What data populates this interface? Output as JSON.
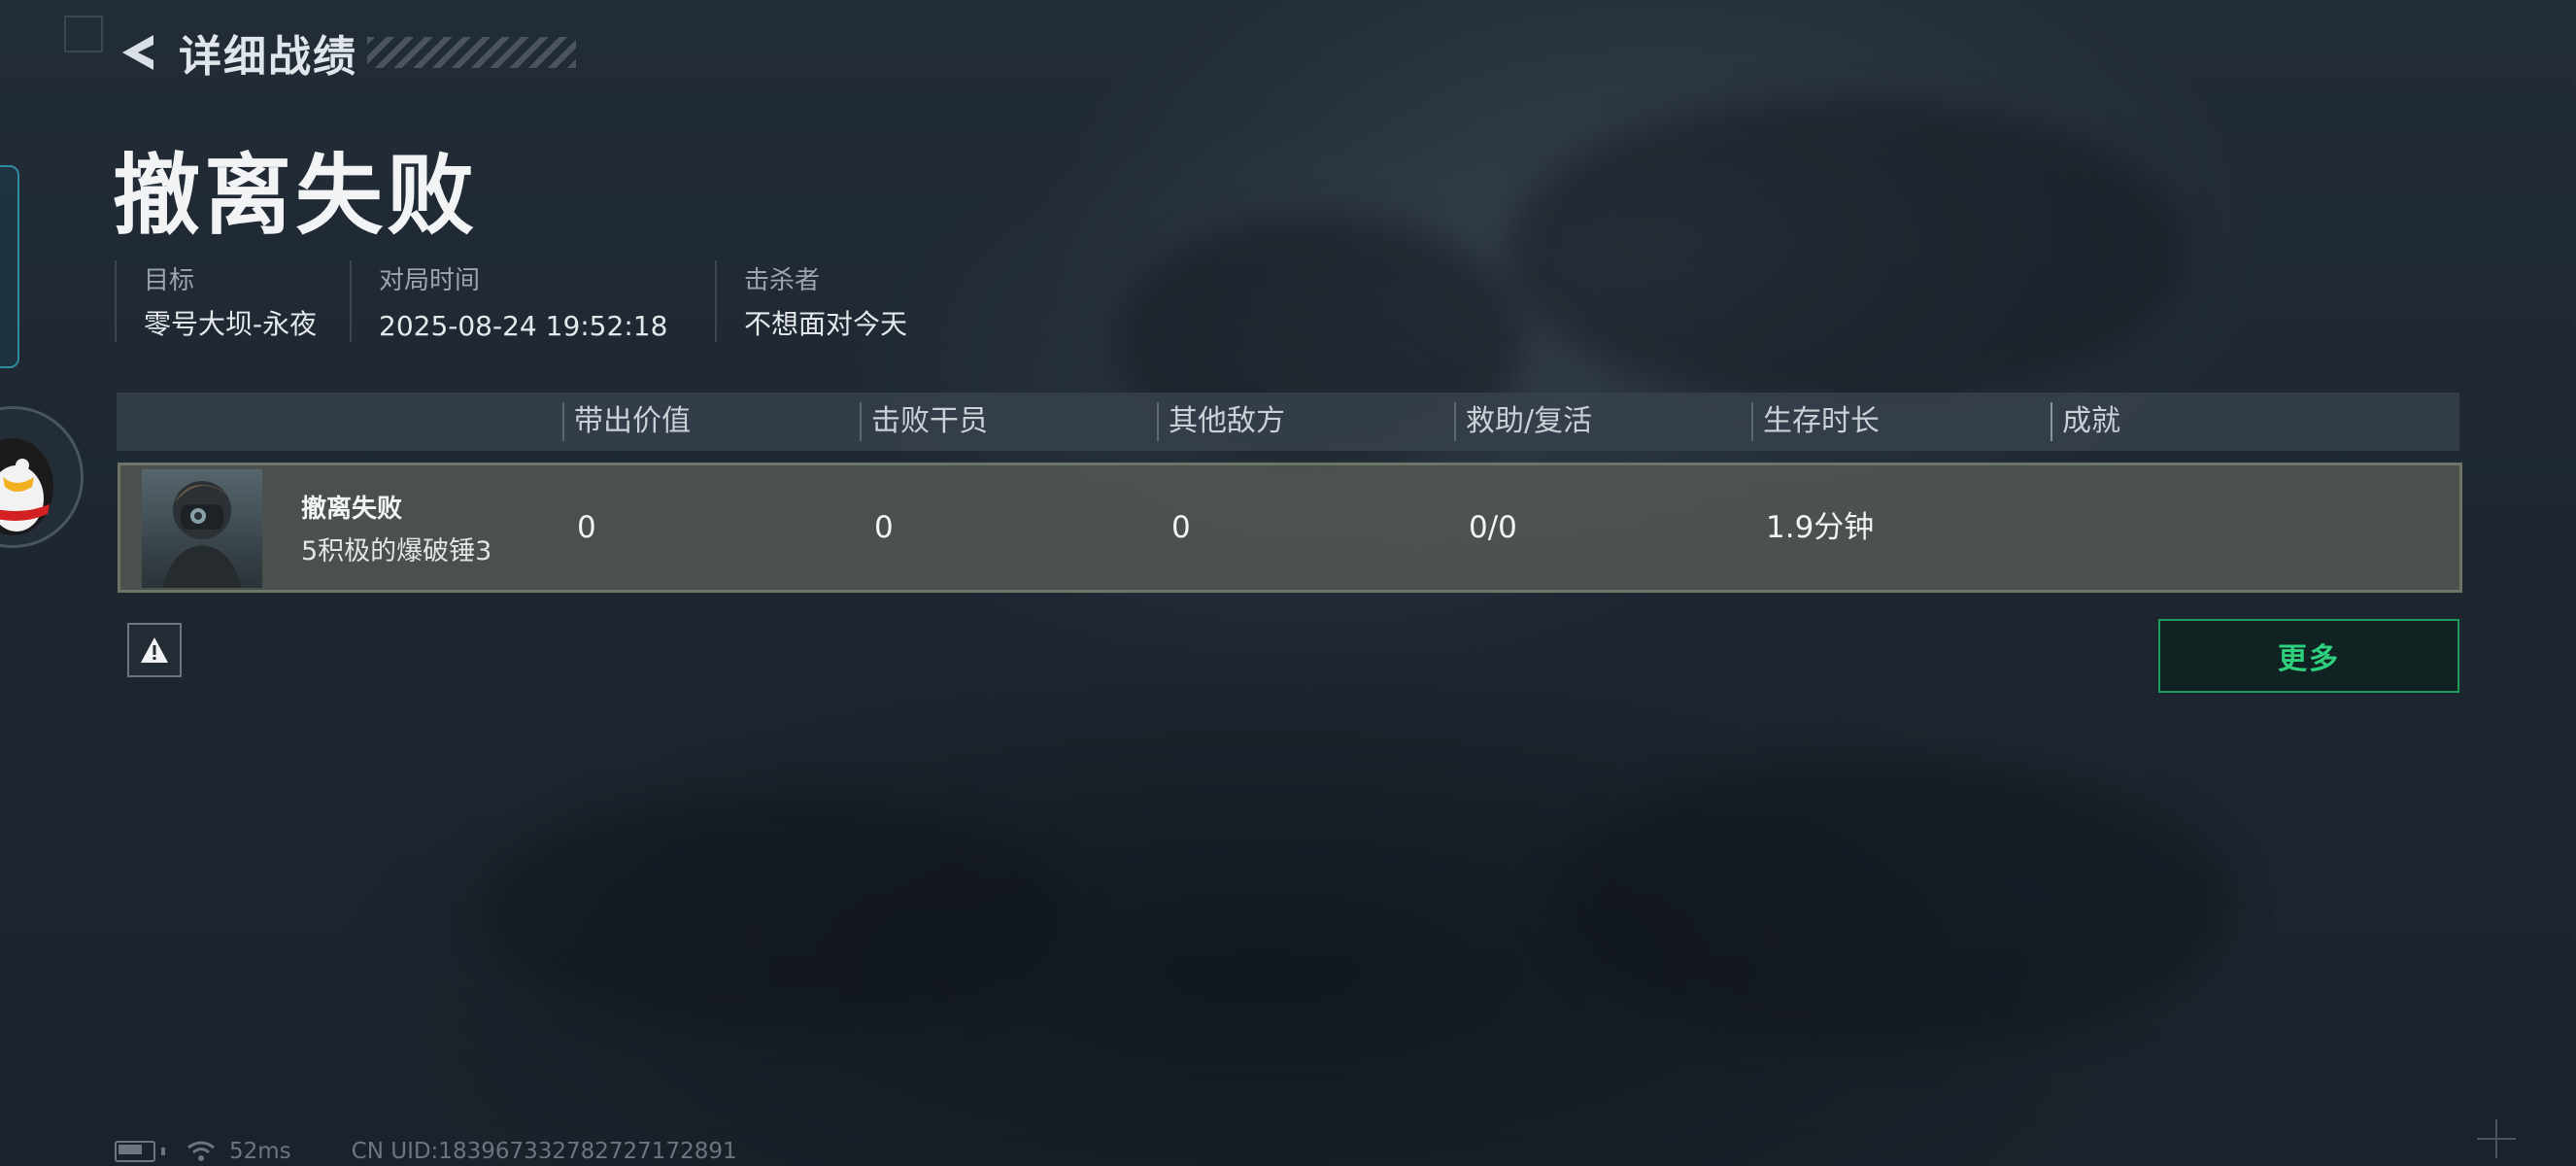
{
  "header": {
    "title": "详细战绩"
  },
  "result": {
    "title": "撤离失败"
  },
  "info": [
    {
      "label": "目标",
      "value": "零号大坝-永夜"
    },
    {
      "label": "对局时间",
      "value": "2025-08-24 19:52:18"
    },
    {
      "label": "击杀者",
      "value": "不想面对今天"
    }
  ],
  "table": {
    "columns": [
      "带出价值",
      "击败干员",
      "其他敌方",
      "救助/复活",
      "生存时长",
      "成就"
    ],
    "row": {
      "status": "撤离失败",
      "name": "5积极的爆破锤3",
      "values": [
        "0",
        "0",
        "0",
        "0/0",
        "1.9分钟",
        ""
      ]
    }
  },
  "buttons": {
    "more": "更多"
  },
  "status_bar": {
    "ping": "52ms",
    "uid": "CN UID:183967332782727172891"
  },
  "colors": {
    "accent_green": "#2ed07d",
    "accent_teal": "#2e8ba0"
  },
  "icons": [
    "back-arrow-icon",
    "warning-icon",
    "battery-icon",
    "wifi-icon",
    "qq-penguin-icon",
    "crosshair-icon"
  ]
}
